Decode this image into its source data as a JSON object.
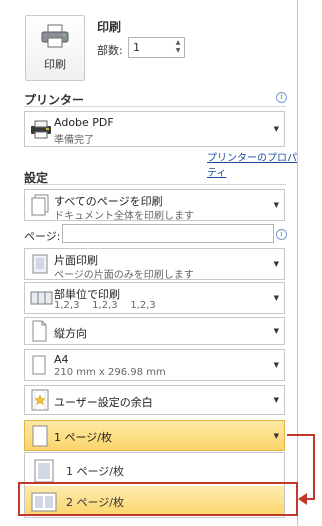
{
  "print": {
    "button_label": "印刷",
    "title": "印刷",
    "copies_label": "部数:",
    "copies_value": "1"
  },
  "printer": {
    "heading": "プリンター",
    "name": "Adobe PDF",
    "status": "準備完了",
    "properties_link": "プリンターのプロパティ"
  },
  "settings": {
    "heading": "設定",
    "pages_label": "ページ:",
    "items": [
      {
        "title": "すべてのページを印刷",
        "sub": "ドキュメント全体を印刷します",
        "icon": "document-pages-icon"
      },
      {
        "title": "片面印刷",
        "sub": "ページの片面のみを印刷します",
        "icon": "single-sided-icon"
      },
      {
        "title": "部単位で印刷",
        "sub": "1,2,3    1,2,3    1,2,3",
        "icon": "collated-icon"
      },
      {
        "title": "縦方向",
        "sub": "",
        "icon": "portrait-icon"
      },
      {
        "title": "A4",
        "sub": "210 mm x 296.98 mm",
        "icon": "paper-size-icon"
      },
      {
        "title": "ユーザー設定の余白",
        "sub": "",
        "icon": "margins-icon"
      },
      {
        "title": "1 ページ/枚",
        "sub": "",
        "icon": "pages-per-sheet-icon"
      }
    ]
  },
  "dropdown_list": {
    "options": [
      "1 ページ/枚",
      "2 ページ/枚"
    ]
  },
  "colors": {
    "selected_bg": "#fbd56b",
    "highlight_red": "#c0392b",
    "link": "#1f4e9c"
  }
}
